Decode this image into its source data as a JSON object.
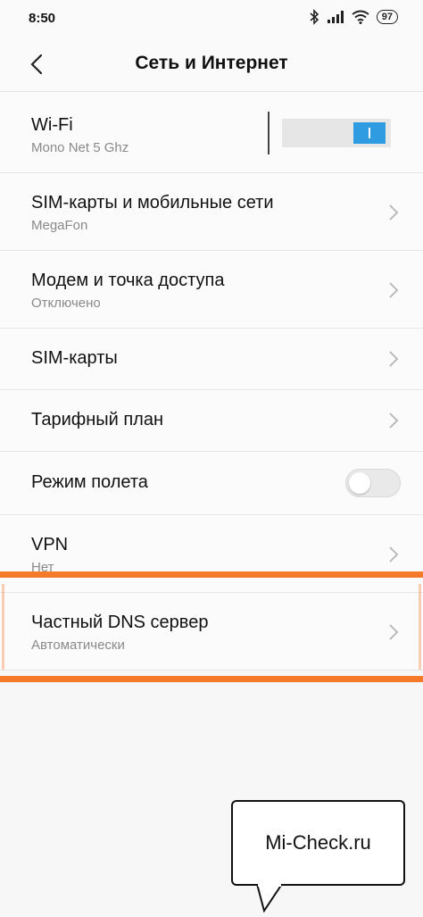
{
  "status_bar": {
    "time": "8:50",
    "battery": "97",
    "icons": [
      "bluetooth-icon",
      "signal-icon",
      "wifi-icon",
      "battery-icon"
    ]
  },
  "header": {
    "title": "Сеть и Интернет",
    "back_icon": "chevron-left-icon"
  },
  "items": [
    {
      "title": "Wi-Fi",
      "subtitle": "Mono Net 5 Ghz",
      "control": "toggle",
      "on": true
    },
    {
      "title": "SIM-карты и мобильные сети",
      "subtitle": "MegaFon",
      "control": "chevron"
    },
    {
      "title": "Модем и точка доступа",
      "subtitle": "Отключено",
      "control": "chevron"
    },
    {
      "title": "SIM-карты",
      "control": "chevron"
    },
    {
      "title": "Тарифный план",
      "control": "chevron"
    },
    {
      "title": "Режим полета",
      "control": "toggle",
      "on": false
    },
    {
      "title": "VPN",
      "subtitle": "Нет",
      "control": "chevron"
    },
    {
      "title": "Частный DNS сервер",
      "subtitle": "Автоматически",
      "control": "chevron",
      "highlighted": true
    }
  ],
  "colors": {
    "accent": "#2f9be0",
    "highlight": "#f47a2a",
    "background": "#f7f7f7",
    "secondary_text": "#8a8a8a"
  },
  "watermark": {
    "text": "Mi-Check.ru"
  }
}
